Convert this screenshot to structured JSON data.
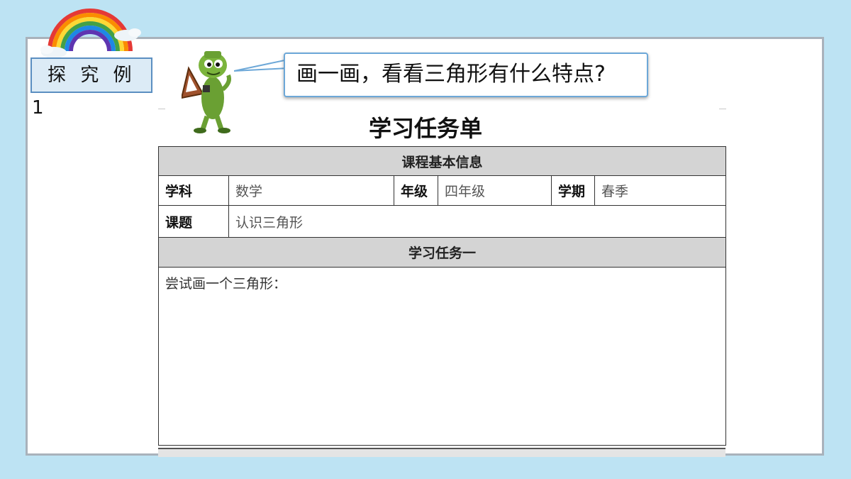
{
  "header": {
    "tag_label": "探 究 例1",
    "speech_text": "画一画，看看三角形有什么特点?"
  },
  "document": {
    "title": "学习任务单",
    "section_basic": "课程基本信息",
    "row1": {
      "subject_label": "学科",
      "subject_value": "数学",
      "grade_label": "年级",
      "grade_value": "四年级",
      "term_label": "学期",
      "term_value": "春季"
    },
    "row2": {
      "topic_label": "课题",
      "topic_value": "认识三角形"
    },
    "section_task": "学习任务一",
    "task_prompt": "尝试画一个三角形："
  },
  "colors": {
    "background": "#bde3f3",
    "tag_fill": "#dcebf6",
    "tag_border": "#5b8fc1",
    "table_header": "#d4d4d4"
  },
  "icons": [
    "rainbow-icon",
    "pencil-mascot-icon"
  ]
}
